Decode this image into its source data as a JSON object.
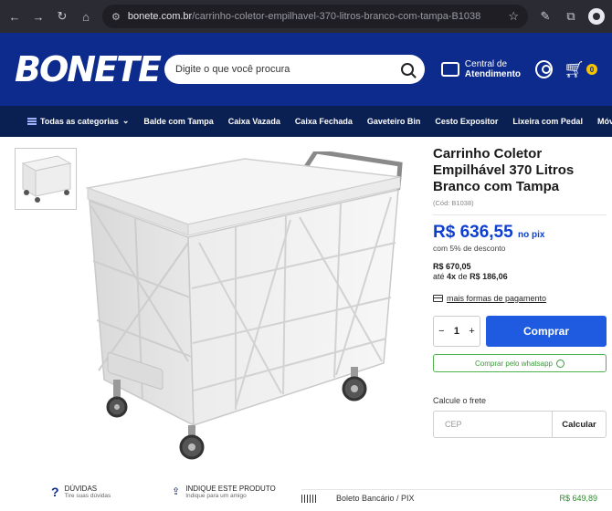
{
  "browser": {
    "url_host": "bonete.com.br",
    "url_path": "/carrinho-coletor-empilhavel-370-litros-branco-com-tampa-B1038"
  },
  "header": {
    "logo": "BONETE",
    "search_placeholder": "Digite o que você procura",
    "service_line1": "Central de",
    "service_line2": "Atendimento",
    "cart_count": "0"
  },
  "categories": {
    "all": "Todas as categorias",
    "items": [
      "Balde com Tampa",
      "Caixa Vazada",
      "Caixa Fechada",
      "Gaveteiro Bin",
      "Cesto Expositor",
      "Lixeira com Pedal",
      "Móveis"
    ]
  },
  "product": {
    "title": "Carrinho Coletor Empilhável 370 Litros Branco com Tampa",
    "code": "(Cód: B1038)",
    "pix_price": "R$ 636,55",
    "pix_suffix": "no pix",
    "pix_discount": "com 5% de desconto",
    "full_price": "R$ 670,05",
    "install_prefix": "até",
    "install_count": "4x",
    "install_mid": "de",
    "install_value": "R$ 186,06",
    "more_payment": "mais formas de pagamento",
    "qty_minus": "−",
    "qty_value": "1",
    "qty_plus": "+",
    "buy_label": "Comprar",
    "whatsapp_label": "Comprar pelo whatsapp",
    "freight_label": "Calcule o frete",
    "cep_placeholder": "CEP",
    "calc_label": "Calcular"
  },
  "footer_strip": {
    "help_title": "DÚVIDAS",
    "help_sub": "Tire suas dúvidas",
    "indicate_title": "INDIQUE ESTE PRODUTO",
    "indicate_sub": "Indique para um amigo",
    "boleto_label": "Boleto Bancário / PIX",
    "boleto_price": "R$ 649,89"
  },
  "colors": {
    "header_blue": "#0d2b8c",
    "category_navy": "#0a1f52",
    "price_blue": "#0d3fd1",
    "buy_blue": "#1f5be0",
    "whatsapp_green": "#3a9b3a"
  }
}
